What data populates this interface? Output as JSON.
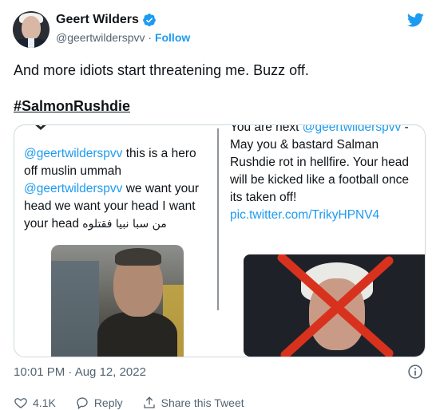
{
  "author": {
    "name": "Geert Wilders",
    "handle": "@geertwilderspvv",
    "separator": " · ",
    "follow_label": "Follow"
  },
  "tweet": {
    "text": "And more idiots start threatening me. Buzz off.",
    "hashtag": "#SalmonRushdie"
  },
  "left_screenshot": {
    "mention1": "@geertwilderspvv",
    "text1": " this is a hero off muslin ummah ",
    "mention2": "@geertwilderspvv",
    "text2": " we want your head we want your head I want your head ",
    "arabic": "من سبا نبيا فقتلوه"
  },
  "right_screenshot": {
    "prefix": "You are next ",
    "mention": "@geertwilderspvv",
    "text": " - May you & bastard Salman Rushdie rot in hellfire. Your head will be kicked like a football once its taken off! ",
    "link": "pic.twitter.com/TrikyHPNV4"
  },
  "meta": {
    "timestamp": "10:01 PM · Aug 12, 2022"
  },
  "actions": {
    "like_count": "4.1K",
    "reply_label": "Reply",
    "share_label": "Share this Tweet"
  },
  "colors": {
    "accent": "#1d9bf0",
    "secondary_text": "#536471",
    "border": "#cfd9de",
    "x_mark": "#d8321e"
  }
}
